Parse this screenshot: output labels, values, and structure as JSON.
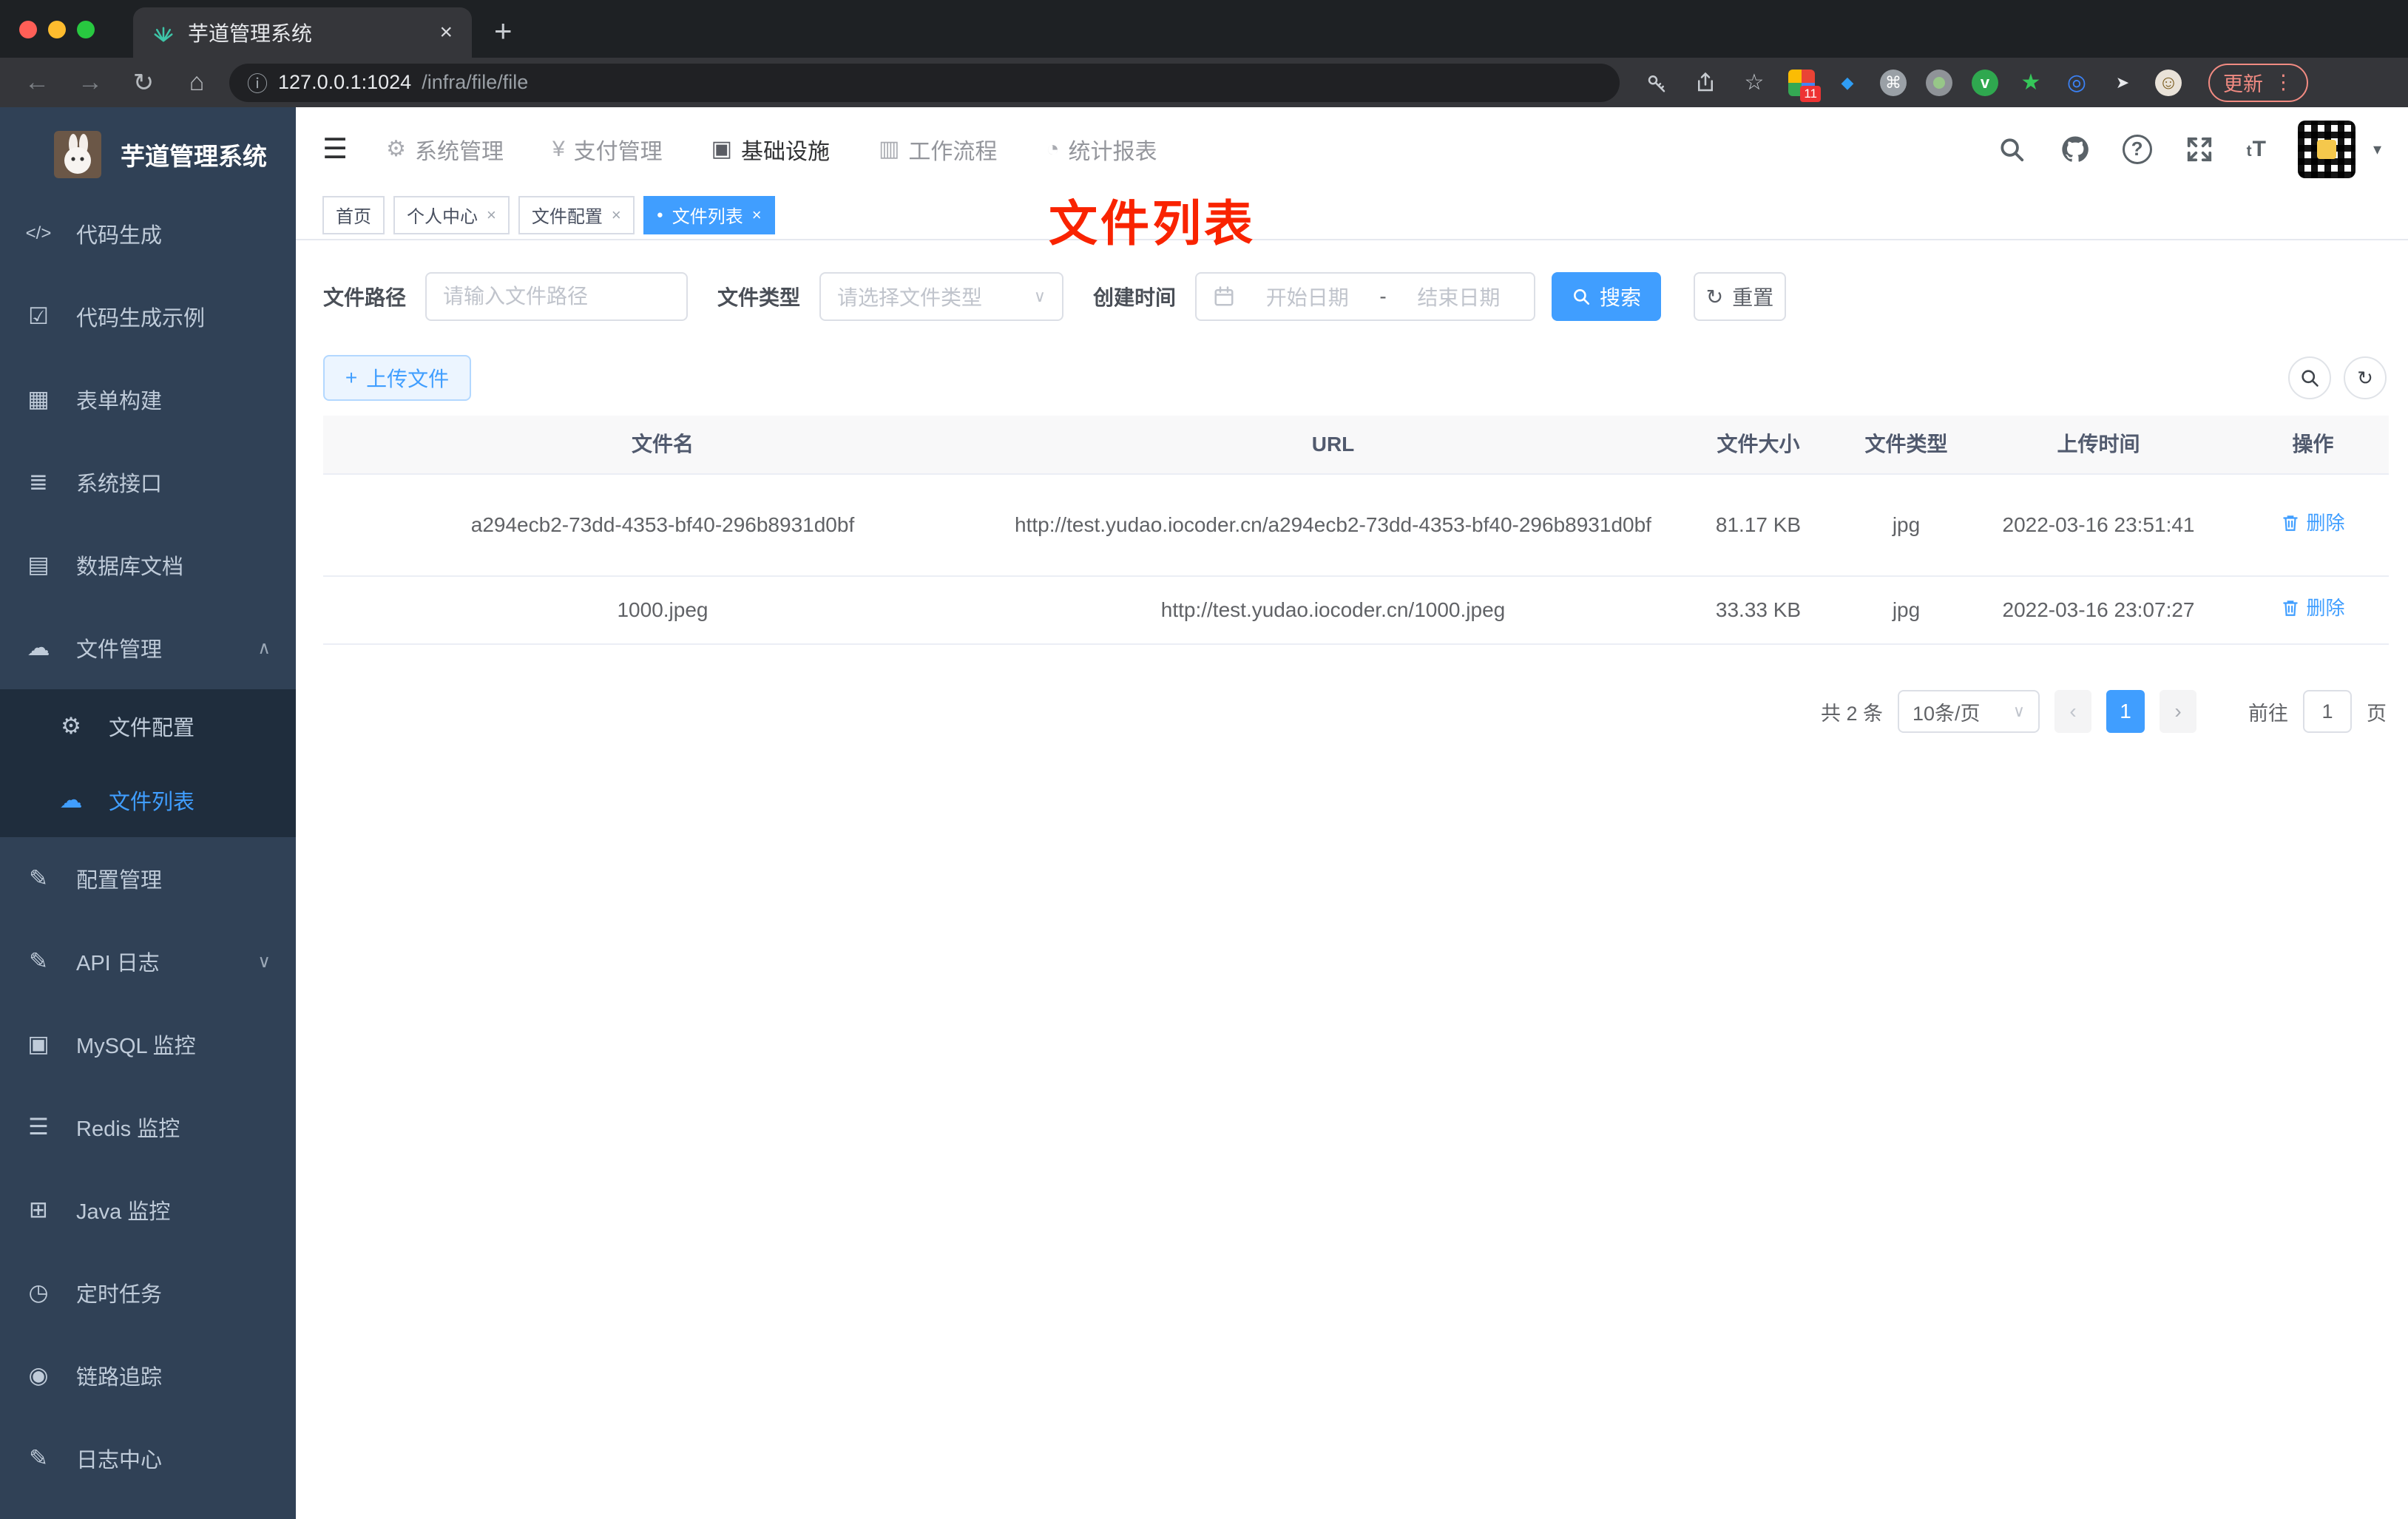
{
  "browser": {
    "tab": {
      "title": "芋道管理系统"
    },
    "toolbar": {
      "url_host": "127.0.0.1:1024",
      "url_path": "/infra/file/file",
      "update_label": "更新",
      "extension_badge": "11"
    }
  },
  "glyphs": {
    "close": "×",
    "plus": "+",
    "back": "←",
    "forward": "→",
    "reload": "↻",
    "home": "⌂",
    "info": "ⓘ",
    "star": "☆",
    "kebab": "⋮",
    "dot": "●",
    "chevron_down": "∨",
    "chevron_up": "∧",
    "caret_down": "▾",
    "prev": "‹",
    "next": "›",
    "question": "?",
    "command": "⌘",
    "smile": "☺",
    "pointer": "➤",
    "diamond": "◆",
    "swirl": "◎",
    "star_solid": "★",
    "v": "v",
    "hamburger": "☰",
    "gear": "⚙",
    "yen": "¥",
    "monitor": "▣",
    "briefcase": "▥",
    "pie": "◔",
    "code": "</>",
    "shield_check": "☑",
    "table": "▦",
    "sliders": "≣",
    "db_grid": "▤",
    "cloud": "☁",
    "edit": "✎",
    "chart": "▣",
    "layers": "☰",
    "java_monitor": "⊞",
    "timer": "◷",
    "eye": "◉",
    "font_size_big": "T",
    "font_size_small": "t",
    "dash": "-"
  },
  "sidebar": {
    "logo_title": "芋道管理系统",
    "items": [
      {
        "label": "代码生成",
        "icon": "code-icon"
      },
      {
        "label": "代码生成示例",
        "icon": "shield-check-icon"
      },
      {
        "label": "表单构建",
        "icon": "table-icon"
      },
      {
        "label": "系统接口",
        "icon": "sliders-icon"
      },
      {
        "label": "数据库文档",
        "icon": "grid-icon"
      },
      {
        "label": "文件管理",
        "icon": "cloud-download-icon"
      },
      {
        "label": "配置管理",
        "icon": "edit-icon"
      },
      {
        "label": "API 日志",
        "icon": "document-edit-icon"
      },
      {
        "label": "MySQL 监控",
        "icon": "chart-icon"
      },
      {
        "label": "Redis 监控",
        "icon": "layers-icon"
      },
      {
        "label": "Java 监控",
        "icon": "monitor-icon"
      },
      {
        "label": "定时任务",
        "icon": "timer-icon"
      },
      {
        "label": "链路追踪",
        "icon": "eye-icon"
      },
      {
        "label": "日志中心",
        "icon": "log-edit-icon"
      }
    ],
    "submenu": [
      {
        "label": "文件配置",
        "icon": "gear-icon"
      },
      {
        "label": "文件列表",
        "icon": "cloud-upload-icon"
      }
    ]
  },
  "topnav": {
    "items": [
      {
        "label": "系统管理",
        "icon": "gear-icon"
      },
      {
        "label": "支付管理",
        "icon": "yen-icon"
      },
      {
        "label": "基础设施",
        "icon": "monitor-icon"
      },
      {
        "label": "工作流程",
        "icon": "briefcase-icon"
      },
      {
        "label": "统计报表",
        "icon": "pie-icon"
      }
    ]
  },
  "tags": {
    "items": [
      {
        "label": "首页"
      },
      {
        "label": "个人中心"
      },
      {
        "label": "文件配置"
      },
      {
        "label": "文件列表"
      }
    ]
  },
  "annotation": {
    "text": "文件列表"
  },
  "filter": {
    "path_label": "文件路径",
    "path_placeholder": "请输入文件路径",
    "type_label": "文件类型",
    "type_placeholder": "请选择文件类型",
    "date_label": "创建时间",
    "date_start": "开始日期",
    "date_sep": "-",
    "date_end": "结束日期",
    "search_label": "搜索",
    "reset_label": "重置"
  },
  "toolbar": {
    "upload_label": "上传文件"
  },
  "table": {
    "headers": [
      "文件名",
      "URL",
      "文件大小",
      "文件类型",
      "上传时间",
      "操作"
    ],
    "rows": [
      {
        "name": "a294ecb2-73dd-4353-bf40-296b8931d0bf",
        "url": "http://test.yudao.iocoder.cn/a294ecb2-73dd-4353-bf40-296b8931d0bf",
        "size": "81.17 KB",
        "type": "jpg",
        "time": "2022-03-16 23:51:41",
        "action": "删除"
      },
      {
        "name": "1000.jpeg",
        "url": "http://test.yudao.iocoder.cn/1000.jpeg",
        "size": "33.33 KB",
        "type": "jpg",
        "time": "2022-03-16 23:07:27",
        "action": "删除"
      }
    ]
  },
  "pagination": {
    "total": "共 2 条",
    "page_size": "10条/页",
    "current": "1",
    "goto_prefix": "前往",
    "goto_value": "1",
    "goto_suffix": "页"
  },
  "colors": {
    "primary": "#409eff",
    "sidebar_bg": "#304156",
    "submenu_bg": "#1f2d3d",
    "sidebar_text": "#bfcbd9",
    "annotation_red": "#f92300",
    "table_header_bg": "#f8f8f9",
    "tag_active_bg": "#409eff",
    "update_button": "#f28b82"
  }
}
